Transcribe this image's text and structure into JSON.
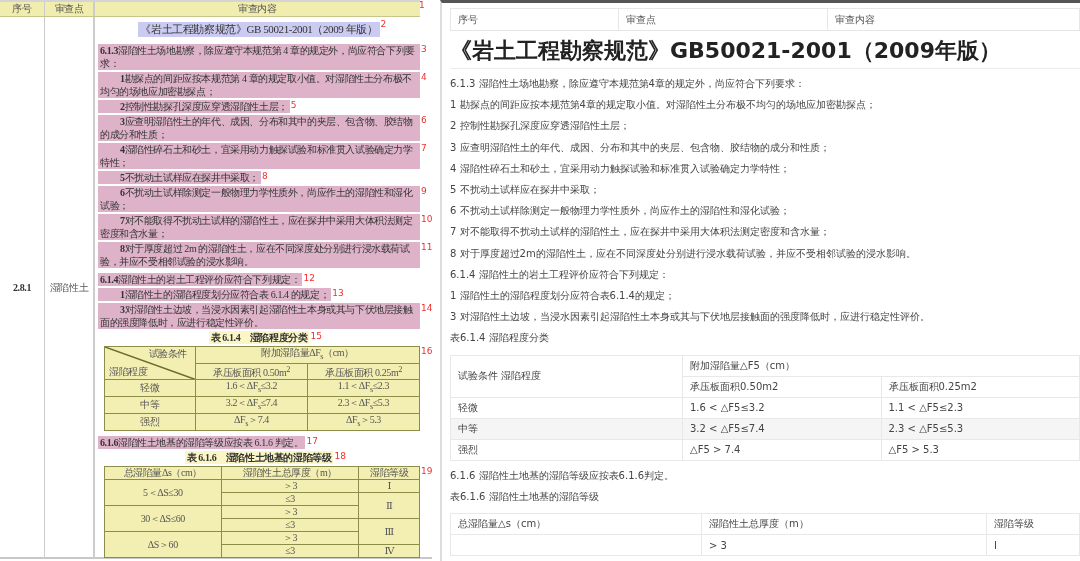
{
  "scan": {
    "columns": [
      "序号",
      "审查点",
      "审查内容"
    ],
    "header_marker": "1",
    "row_number": "2.8.1",
    "review_point": "湿陷性土",
    "blocks": [
      {
        "kind": "heading",
        "text": "《岩土工程勘察规范》GB 50021-2001（2009 年版）",
        "marker": "2"
      },
      {
        "kind": "clause",
        "num": "6.1.3",
        "text": "湿陷性土场地勘察，除应遵守本规范第 4 章的规定外，尚应符合下列要求：",
        "marker": "3"
      },
      {
        "kind": "item",
        "num": "1",
        "text": "勘探点的间距应按本规范第 4 章的规定取小值。对湿陷性土分布极不均匀的场地应加密勘探点；",
        "marker": "4"
      },
      {
        "kind": "item",
        "num": "2",
        "text": "控制性勘探孔深度应穿透湿陷性土层；",
        "marker": "5"
      },
      {
        "kind": "item",
        "num": "3",
        "text": "应查明湿陷性土的年代、成因、分布和其中的夹层、包含物、胶结物的成分和性质；",
        "marker": "6"
      },
      {
        "kind": "item",
        "num": "4",
        "text": "湿陷性碎石土和砂土，宜采用动力触探试验和标准贯入试验确定力学特性；",
        "marker": "7"
      },
      {
        "kind": "item",
        "num": "5",
        "text": "不扰动土试样应在探井中采取；",
        "marker": "8"
      },
      {
        "kind": "item",
        "num": "6",
        "text": "不扰动土试样除测定一般物理力学性质外，尚应作土的湿陷性和湿化试验；",
        "marker": "9"
      },
      {
        "kind": "item",
        "num": "7",
        "text": "对不能取得不扰动土试样的湿陷性土，应在探井中采用大体积法测定密度和含水量；",
        "marker": "10"
      },
      {
        "kind": "item",
        "num": "8",
        "text": "对于厚度超过 2m 的湿陷性土，应在不同深度处分别进行浸水载荷试验，并应不受相邻试验的浸水影响。",
        "marker": "11"
      },
      {
        "kind": "clause",
        "num": "6.1.4",
        "text": "湿陷性土的岩土工程评价应符合下列规定：",
        "marker": "12"
      },
      {
        "kind": "item",
        "num": "1",
        "text": "湿陷性土的湿陷程度划分应符合表 6.1.4 的规定；",
        "marker": "13"
      },
      {
        "kind": "item",
        "num": "3",
        "text": "对湿陷性土边坡，当浸水因素引起湿陷性土本身或其与下伏地层接触面的强度降低时，应进行稳定性评价。",
        "marker": "14"
      },
      {
        "kind": "caption",
        "text": "表 6.1.4　湿陷程度分类",
        "marker": "15"
      },
      {
        "kind": "degree_table",
        "marker": "16",
        "corner_top": "试验条件",
        "corner_bottom": "湿陷程度",
        "group_header": "附加湿陷量ΔF$_{s}$（cm）",
        "sub_headers": [
          "承压板面积 0.50m$^{2}$",
          "承压板面积 0.25m$^{2}$"
        ],
        "rows": [
          {
            "label": "轻微",
            "values": [
              "1.6＜ΔF$_{s}$≤3.2",
              "1.1＜ΔF$_{s}$≤2.3"
            ]
          },
          {
            "label": "中等",
            "values": [
              "3.2＜ΔF$_{s}$≤7.4",
              "2.3＜ΔF$_{s}$≤5.3"
            ]
          },
          {
            "label": "强烈",
            "values": [
              "ΔF$_{s}$＞7.4",
              "ΔF$_{s}$＞5.3"
            ]
          }
        ]
      },
      {
        "kind": "clause",
        "num": "6.1.6",
        "text": "湿陷性土地基的湿陷等级应按表 6.1.6 判定。",
        "marker": "17"
      },
      {
        "kind": "caption",
        "text": "表 6.1.6　湿陷性土地基的湿陷等级",
        "marker": "18"
      },
      {
        "kind": "grade_table",
        "marker": "19",
        "headers": [
          "总湿陷量Δs（cm）",
          "湿陷性土总厚度（m）",
          "湿陷等级"
        ],
        "rows": [
          {
            "settlement": "5＜ΔS≤30",
            "thickness": "＞3",
            "grade": "Ⅰ"
          },
          {
            "thickness": "≤3",
            "grade": "Ⅱ"
          },
          {
            "settlement": "30＜ΔS≤60",
            "thickness": "＞3"
          },
          {
            "thickness": "≤3",
            "grade": "Ⅲ"
          },
          {
            "settlement": "ΔS＞60",
            "thickness": "＞3"
          },
          {
            "thickness": "≤3",
            "grade": "Ⅳ"
          }
        ]
      }
    ]
  },
  "web": {
    "columns": [
      "序号",
      "审查点",
      "审查内容"
    ],
    "title": "《岩土工程勘察规范》GB50021-2001（2009年版）",
    "paragraphs": [
      "6.1.3 湿陷性土场地勘察，除应遵守本规范第4章的规定外，尚应符合下列要求：",
      "1 勘探点的间距应按本规范第4章的规定取小值。对湿陷性土分布极不均匀的场地应加密勘探点；",
      "2 控制性勘探孔深度应穿透湿陷性土层；",
      "3 应查明湿陷性土的年代、成因、分布和其中的夹层、包含物、胶结物的成分和性质；",
      "4 湿陷性碎石土和砂土，宜采用动力触探试验和标准贯入试验确定力学特性；",
      "5 不扰动土试样应在探井中采取；",
      "6 不扰动土试样除测定一般物理力学性质外，尚应作土的湿陷性和湿化试验；",
      "7 对不能取得不扰动土试样的湿陷性土，应在探井中采用大体积法测定密度和含水量；",
      "8 对于厚度超过2m的湿陷性土，应在不同深度处分别进行浸水载荷试验，并应不受相邻试验的浸水影响。",
      "6.1.4 湿陷性土的岩土工程评价应符合下列规定：",
      "1 湿陷性土的湿陷程度划分应符合表6.1.4的规定；",
      "3 对湿陷性土边坡，当浸水因素引起湿陷性土本身或其与下伏地层接触面的强度降低时，应进行稳定性评价。",
      "表6.1.4 湿陷程度分类"
    ],
    "table_1": {
      "corner": "试验条件 湿陷程度",
      "group_header": "附加湿陷量△F5（cm）",
      "sub_headers": [
        "承压板面积0.50m2",
        "承压板面积0.25m2"
      ],
      "rows": [
        {
          "label": "轻微",
          "values": [
            "1.6 < △F5≤3.2",
            "1.1 < △F5≤2.3"
          ]
        },
        {
          "label": "中等",
          "values": [
            "3.2 < △F5≤7.4",
            "2.3 < △F5≤5.3"
          ]
        },
        {
          "label": "强烈",
          "values": [
            "△F5 > 7.4",
            "△F5 > 5.3"
          ]
        }
      ]
    },
    "paragraphs_2": [
      "6.1.6 湿陷性土地基的湿陷等级应按表6.1.6判定。",
      "表6.1.6 湿陷性土地基的湿陷等级"
    ],
    "table_2": {
      "headers": [
        "总湿陷量△s（cm）",
        "湿陷性土总厚度（m）",
        "湿陷等级"
      ],
      "rows": [
        {
          "thickness": "> 3",
          "grade": "I"
        }
      ]
    }
  }
}
